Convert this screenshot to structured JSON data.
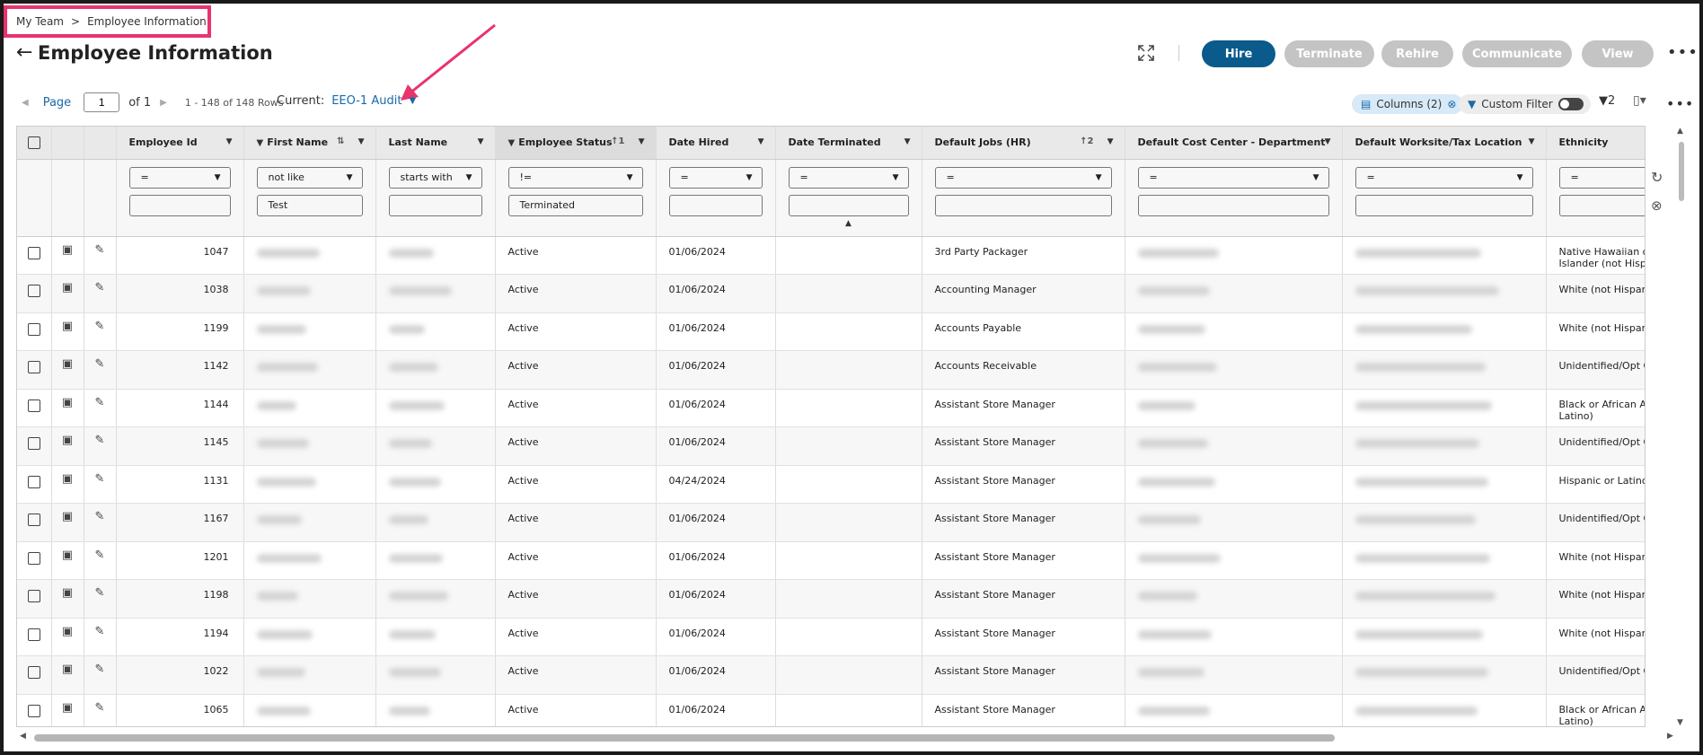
{
  "breadcrumb": {
    "parent": "My Team",
    "separator": ">",
    "current": "Employee Information"
  },
  "page": {
    "title": "Employee Information"
  },
  "actions": {
    "hire": "Hire",
    "terminate": "Terminate",
    "rehire": "Rehire",
    "communicate": "Communicate",
    "view": "View"
  },
  "pager": {
    "label": "Page",
    "page_number": "1",
    "of_label": "of 1",
    "rows_info": "1 - 148 of 148 Rows"
  },
  "view": {
    "current_label": "Current:",
    "name": "EEO-1 Audit"
  },
  "toolbar": {
    "columns_chip": "Columns (2)",
    "custom_filter_label": "Custom Filter",
    "filter_count": "2"
  },
  "columns": {
    "employee_id": "Employee Id",
    "first_name": "First Name",
    "last_name": "Last Name",
    "employee_status": "Employee Status",
    "date_hired": "Date Hired",
    "date_terminated": "Date Terminated",
    "default_jobs": "Default Jobs (HR)",
    "cost_center": "Default Cost Center - Department",
    "worksite": "Default Worksite/Tax Location",
    "ethnicity": "Ethnicity"
  },
  "sort_indicators": {
    "employee_status": "1",
    "default_jobs": "2"
  },
  "filters": {
    "employee_id": {
      "operator": "=",
      "value": ""
    },
    "first_name": {
      "operator": "not like",
      "value": "Test"
    },
    "last_name": {
      "operator": "starts with",
      "value": ""
    },
    "employee_status": {
      "operator": "!=",
      "value": "Terminated"
    },
    "date_hired": {
      "operator": "=",
      "value": ""
    },
    "date_terminated": {
      "operator": "=",
      "value": ""
    },
    "default_jobs": {
      "operator": "=",
      "value": ""
    },
    "cost_center": {
      "operator": "=",
      "value": ""
    },
    "worksite": {
      "operator": "=",
      "value": ""
    },
    "ethnicity": {
      "operator": "=",
      "value": ""
    }
  },
  "rows": [
    {
      "id": "1047",
      "status": "Active",
      "hired": "01/06/2024",
      "job": "3rd Party Packager",
      "ethnicity": "Native Hawaiian or Islander (not Hispanic"
    },
    {
      "id": "1038",
      "status": "Active",
      "hired": "01/06/2024",
      "job": "Accounting Manager",
      "ethnicity": "White (not Hispanic"
    },
    {
      "id": "1199",
      "status": "Active",
      "hired": "01/06/2024",
      "job": "Accounts Payable",
      "ethnicity": "White (not Hispanic"
    },
    {
      "id": "1142",
      "status": "Active",
      "hired": "01/06/2024",
      "job": "Accounts Receivable",
      "ethnicity": "Unidentified/Opt Ou"
    },
    {
      "id": "1144",
      "status": "Active",
      "hired": "01/06/2024",
      "job": "Assistant Store Manager",
      "ethnicity": "Black or African Am or Latino)"
    },
    {
      "id": "1145",
      "status": "Active",
      "hired": "01/06/2024",
      "job": "Assistant Store Manager",
      "ethnicity": "Unidentified/Opt Ou"
    },
    {
      "id": "1131",
      "status": "Active",
      "hired": "04/24/2024",
      "job": "Assistant Store Manager",
      "ethnicity": "Hispanic or Latino"
    },
    {
      "id": "1167",
      "status": "Active",
      "hired": "01/06/2024",
      "job": "Assistant Store Manager",
      "ethnicity": "Unidentified/Opt Ou"
    },
    {
      "id": "1201",
      "status": "Active",
      "hired": "01/06/2024",
      "job": "Assistant Store Manager",
      "ethnicity": "White (not Hispanic"
    },
    {
      "id": "1198",
      "status": "Active",
      "hired": "01/06/2024",
      "job": "Assistant Store Manager",
      "ethnicity": "White (not Hispanic"
    },
    {
      "id": "1194",
      "status": "Active",
      "hired": "01/06/2024",
      "job": "Assistant Store Manager",
      "ethnicity": "White (not Hispanic"
    },
    {
      "id": "1022",
      "status": "Active",
      "hired": "01/06/2024",
      "job": "Assistant Store Manager",
      "ethnicity": "Unidentified/Opt Ou"
    },
    {
      "id": "1065",
      "status": "Active",
      "hired": "01/06/2024",
      "job": "Assistant Store Manager",
      "ethnicity": "Black or African Am or Latino)"
    }
  ],
  "colors": {
    "primary": "#0a5a8c",
    "disabled_button": "#c4c4c4",
    "annotation": "#e8336c",
    "link": "#1a6aa8"
  }
}
